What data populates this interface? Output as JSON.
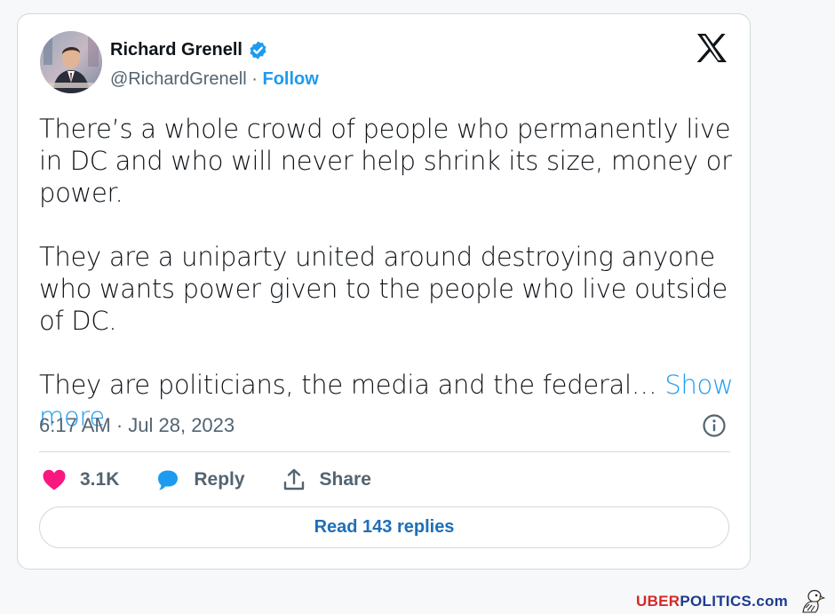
{
  "author": {
    "name": "Richard Grenell",
    "handle": "@RichardGrenell",
    "separator": "·",
    "follow_label": "Follow"
  },
  "tweet": {
    "paragraph_1": "There’s a whole crowd of people who permanently live in DC and who will never help shrink its size, money or power.",
    "paragraph_2": "They are a uniparty united around destroying anyone who wants power given to the people who live outside of DC.",
    "paragraph_3": "They are politicians, the media and the federal…",
    "show_more_label": "Show more",
    "timestamp": "6:17 AM · Jul 28, 2023"
  },
  "actions": {
    "likes_count": "3.1K",
    "reply_label": "Reply",
    "share_label": "Share"
  },
  "read_replies_label": "Read 143 replies",
  "watermark": {
    "part_red": "UBER",
    "part_blue": "POLITICS.com"
  },
  "icons": {
    "verified": "verified-badge-icon",
    "platform": "x-logo-icon",
    "info": "info-icon",
    "like": "heart-icon",
    "reply": "speech-bubble-icon",
    "share": "share-upload-icon"
  },
  "colors": {
    "accent": "#1d9bf0",
    "like": "#f91880",
    "text": "#0f1419",
    "muted": "#536471",
    "border": "#cfd9de"
  }
}
